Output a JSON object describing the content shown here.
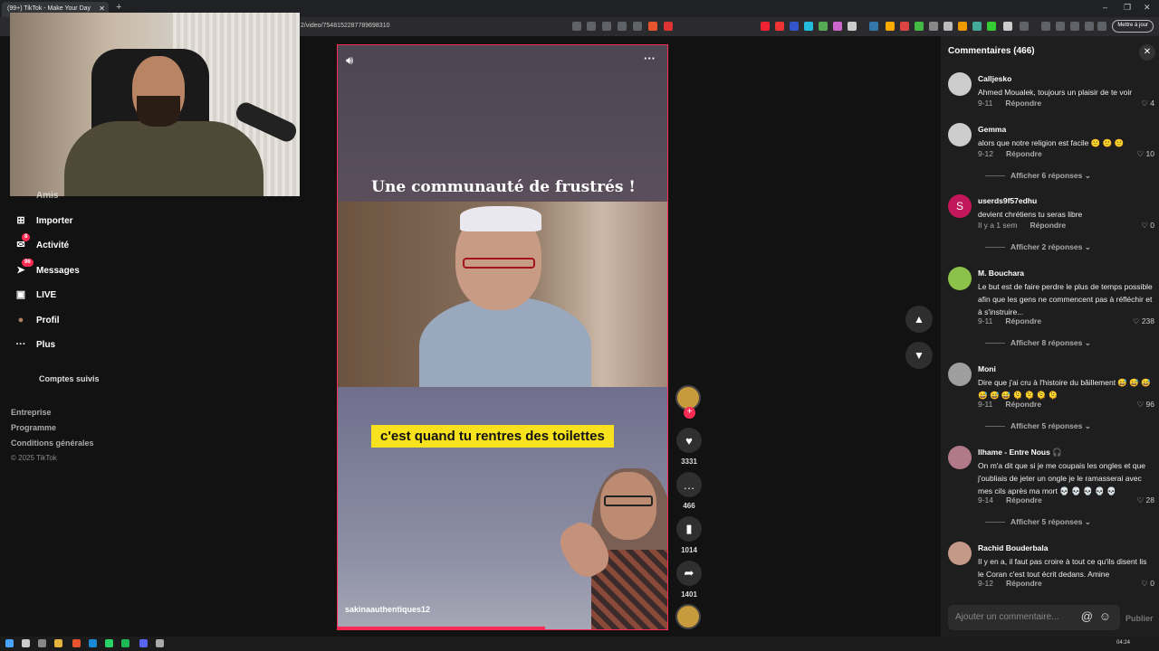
{
  "browser": {
    "tab_title": "(99+) TikTok - Make Your Day",
    "tab_close": "✕",
    "new_tab": "+",
    "url": "2/video/7548152287789698310",
    "update_label": "Mettre à jour",
    "min": "–",
    "max": "❐",
    "close": "✕"
  },
  "sidebar": {
    "partial_item": "Amis",
    "items": [
      {
        "label": "Importer",
        "icon": "upload-icon",
        "glyph": "⊞"
      },
      {
        "label": "Activité",
        "icon": "activity-icon",
        "glyph": "✉",
        "badge": "8"
      },
      {
        "label": "Messages",
        "icon": "messages-icon",
        "glyph": "➤",
        "badge": "96"
      },
      {
        "label": "LIVE",
        "icon": "live-icon",
        "glyph": "▣"
      },
      {
        "label": "Profil",
        "icon": "profile-avatar-icon",
        "glyph": "●"
      },
      {
        "label": "Plus",
        "icon": "more-icon",
        "glyph": "···"
      }
    ],
    "following_label": "Comptes suivis",
    "footer": [
      "Entreprise",
      "Programme",
      "Conditions générales"
    ],
    "copyright": "© 2025 TikTok"
  },
  "video": {
    "headline": "Une communauté de frustrés !",
    "caption": "c'est quand tu rentres des toilettes",
    "username": "sakinaauthentiques12",
    "progress": 0.63
  },
  "actions": {
    "plus": "+",
    "likes": "3331",
    "comments": "466",
    "saves": "1014",
    "shares": "1401"
  },
  "comments_panel": {
    "title": "Commentaires (466)",
    "close": "✕",
    "input_placeholder": "Ajouter un commentaire...",
    "publish": "Publier",
    "at": "@",
    "emoji": "☺",
    "comments": [
      {
        "name": "Calljesko",
        "text": "Ahmed Moualek, toujours un plaisir de te voir",
        "date": "9-11",
        "reply": "Répondre",
        "likes": "4",
        "avatar_color": "#d0d0d0"
      },
      {
        "name": "Gemma",
        "text": "alors que notre religion est facile 🙂 🙂 🙂",
        "date": "9-12",
        "reply": "Répondre",
        "likes": "10",
        "replies": "Afficher 6 réponses",
        "avatar_color": "#d0d0d0"
      },
      {
        "name": "userds9f57edhu",
        "text": "devient chrétiens tu seras libre",
        "date": "Il y a 1 sem",
        "reply": "Répondre",
        "likes": "0",
        "replies": "Afficher 2 réponses",
        "avatar_color": "#c2185b",
        "avatar_letter": "S"
      },
      {
        "name": "M. Bouchara",
        "text": "Le but est de faire perdre le plus de temps possible afin que les gens ne commencent pas à réfléchir et à s'instruire...",
        "date": "9-11",
        "reply": "Répondre",
        "likes": "238",
        "replies": "Afficher 8 réponses",
        "avatar_color": "#8bc34a"
      },
      {
        "name": "Moni",
        "text": "Dire que j'ai cru à l'histoire du bâillement 😅 😅 😅 😅 😅 😅 🫠 🫠 🫠 🫠",
        "date": "9-11",
        "reply": "Répondre",
        "likes": "96",
        "replies": "Afficher 5 réponses",
        "avatar_color": "#9e9e9e"
      },
      {
        "name": "Ilhame - Entre Nous 🎧",
        "text": "On m'a dit que si je me coupais les ongles et que j'oubliais de jeter un ongle je le ramasserai avec mes cils après ma mort 💀 💀 💀 💀 💀",
        "date": "9-14",
        "reply": "Répondre",
        "likes": "28",
        "replies": "Afficher 5 réponses",
        "avatar_color": "#b07a8a"
      },
      {
        "name": "Rachid Bouderbala",
        "text": "Il y en a, il faut pas croire à tout ce qu'ils disent lis le Coran c'est tout écrit dedans. Amine",
        "date": "9-12",
        "reply": "Répondre",
        "likes": "0",
        "avatar_color": "#c49a86"
      }
    ]
  },
  "taskbar": {
    "time": "04:24"
  }
}
